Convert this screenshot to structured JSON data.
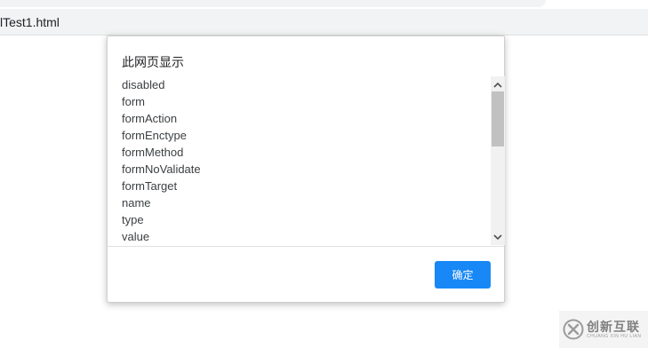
{
  "browser": {
    "address": "lTest1.html"
  },
  "dialog": {
    "title": "此网页显示",
    "items": [
      "disabled",
      "form",
      "formAction",
      "formEnctype",
      "formMethod",
      "formNoValidate",
      "formTarget",
      "name",
      "type",
      "value"
    ],
    "ok_label": "确定"
  },
  "watermark": {
    "text": "创新互联",
    "subtext": "CHUANG XIN HU LIAN"
  },
  "colors": {
    "button": "#1888f6",
    "addressbar": "#f1f3f4",
    "scrollthumb": "#c1c1c1"
  }
}
